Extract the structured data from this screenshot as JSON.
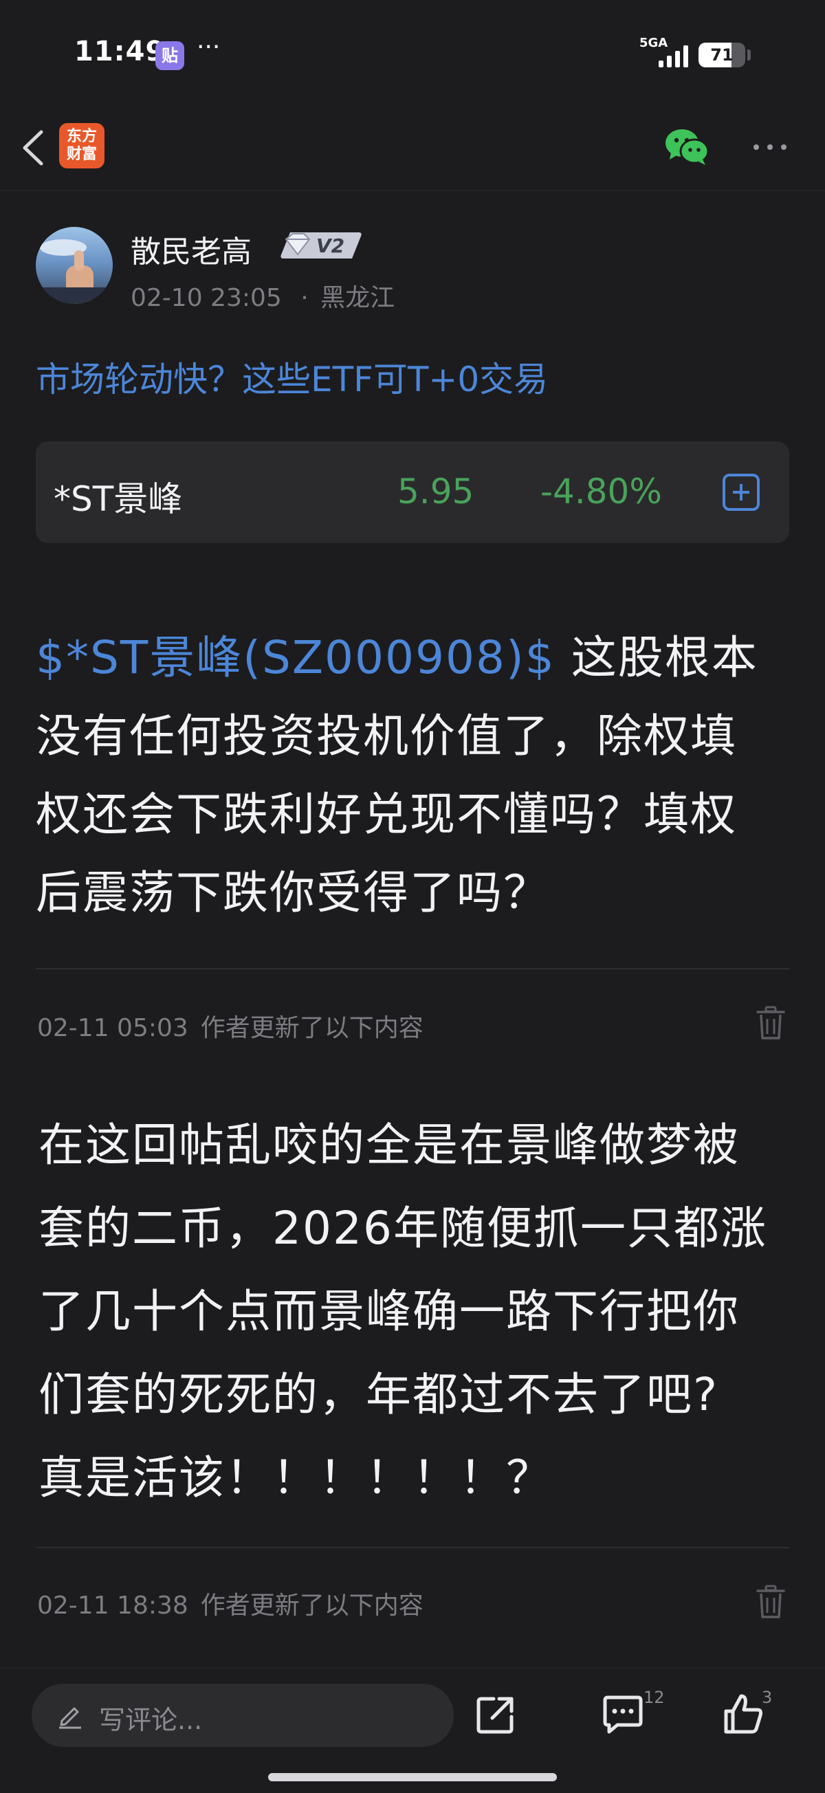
{
  "status_bar": {
    "time": "11:49",
    "app_icon_label": "贴",
    "more": "···",
    "network": "5GA",
    "battery_level": 71,
    "battery_text": "71"
  },
  "nav": {
    "brand_logo_text": "东方\n财富",
    "share_channel_icon": "wechat-icon",
    "more_icon": "more-horizontal-icon"
  },
  "post": {
    "author": {
      "name": "散民老高",
      "level": "V2"
    },
    "date": "02-10 23:05",
    "location_sep": "·",
    "location": "黑龙江",
    "promo_link": "市场轮动快？这些ETF可T+0交易",
    "stock": {
      "name": "*ST景峰",
      "price": "5.95",
      "change": "-4.80%",
      "color": "#49a35a"
    },
    "body": {
      "stock_tag": "$*ST景峰(SZ000908)$",
      "lines": [
        " 这股根本",
        "没有任何投资投机价值了，除权填",
        "权还会下跌利好兑现不懂吗？填权",
        "后震荡下跌你受得了吗？"
      ]
    },
    "updates": [
      {
        "time": "02-11 05:03",
        "label": "作者更新了以下内容",
        "lines": [
          "在这回帖乱咬的全是在景峰做梦被",
          "套的二币，2026年随便抓一只都涨",
          "了几十个点而景峰确一路下行把你",
          "们套的死死的，年都过不去了吧?",
          "真是活该！！！！！！？"
        ]
      },
      {
        "time": "02-11 18:38",
        "label": "作者更新了以下内容"
      }
    ]
  },
  "bottom_bar": {
    "comment_placeholder": "写评论...",
    "comment_count": "12",
    "like_count": "3"
  },
  "colors": {
    "background": "#1c1c1e",
    "link_blue": "#4c86d8",
    "down_green": "#49a35a",
    "brand_orange": "#e8582a",
    "wechat_green": "#3ec35a"
  }
}
